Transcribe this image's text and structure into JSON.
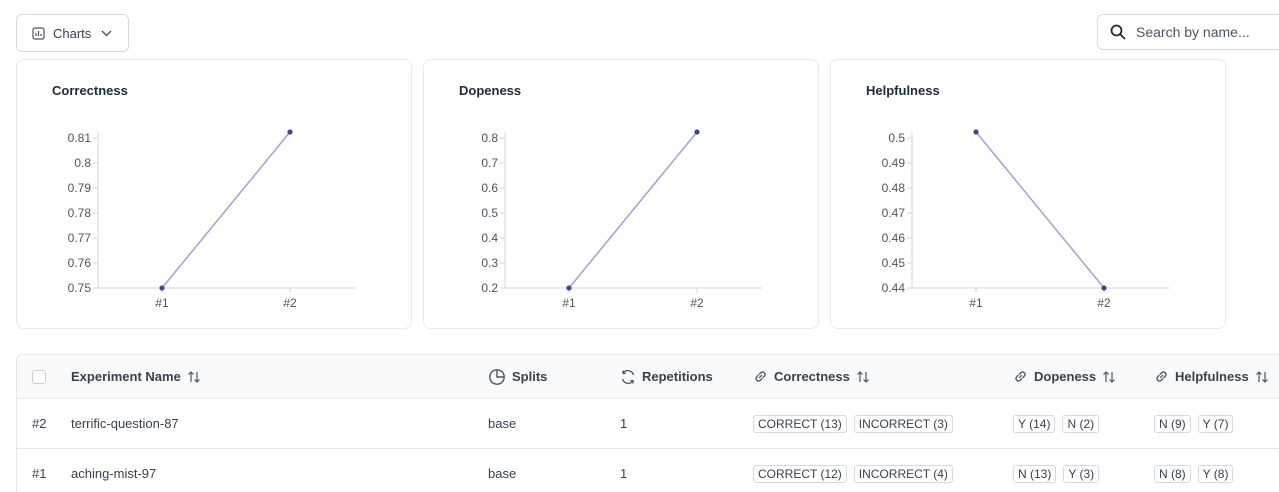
{
  "toolbar": {
    "charts_label": "Charts",
    "search_placeholder": "Search by name..."
  },
  "chart_data": [
    {
      "type": "line",
      "title": "Correctness",
      "categories": [
        "#1",
        "#2"
      ],
      "values": [
        0.75,
        0.8125
      ],
      "yticks": [
        "0.81",
        "0.8",
        "0.79",
        "0.78",
        "0.77",
        "0.76",
        "0.75"
      ],
      "ylim": [
        0.75,
        0.8125
      ],
      "xlabel": "",
      "ylabel": "",
      "color": "#9ea3cd",
      "point_color": "#3b4a8a"
    },
    {
      "type": "line",
      "title": "Dopeness",
      "categories": [
        "#1",
        "#2"
      ],
      "values": [
        0.2,
        0.875
      ],
      "yticks": [
        "0.8",
        "0.7",
        "0.6",
        "0.5",
        "0.4",
        "0.3",
        "0.2"
      ],
      "ylim": [
        0.2,
        0.875
      ],
      "xlabel": "",
      "ylabel": "",
      "color": "#9ea3cd",
      "point_color": "#3b4a8a"
    },
    {
      "type": "line",
      "title": "Helpfulness",
      "categories": [
        "#1",
        "#2"
      ],
      "values": [
        0.5,
        0.4375
      ],
      "yticks": [
        "0.5",
        "0.49",
        "0.48",
        "0.47",
        "0.46",
        "0.45",
        "0.44"
      ],
      "ylim": [
        0.4375,
        0.5
      ],
      "xlabel": "",
      "ylabel": "",
      "color": "#9ea3cd",
      "point_color": "#3b4a8a"
    }
  ],
  "table": {
    "headers": {
      "name": "Experiment Name",
      "splits": "Splits",
      "repetitions": "Repetitions",
      "correctness": "Correctness",
      "dopeness": "Dopeness",
      "helpfulness": "Helpfulness"
    },
    "rows": [
      {
        "id": "#2",
        "name": "terrific-question-87",
        "split": "base",
        "repetitions": "1",
        "correctness": [
          "CORRECT (13)",
          "INCORRECT (3)"
        ],
        "dopeness": [
          "Y (14)",
          "N (2)"
        ],
        "helpfulness": [
          "N (9)",
          "Y (7)"
        ]
      },
      {
        "id": "#1",
        "name": "aching-mist-97",
        "split": "base",
        "repetitions": "1",
        "correctness": [
          "CORRECT (12)",
          "INCORRECT (4)"
        ],
        "dopeness": [
          "N (13)",
          "Y (3)"
        ],
        "helpfulness": [
          "N (8)",
          "Y (8)"
        ]
      }
    ]
  }
}
